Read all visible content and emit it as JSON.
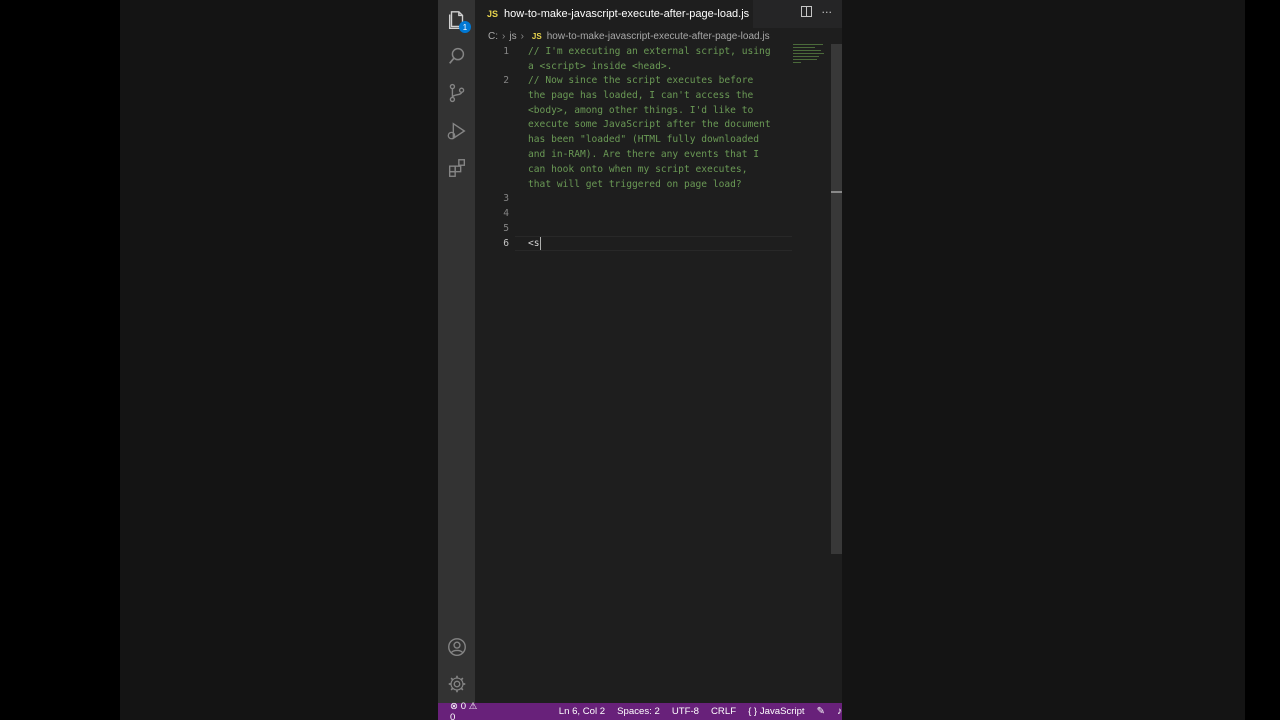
{
  "window": {
    "tab_title": "how-to-make-javascript-execute-after-page-load.js",
    "tab_lang_badge": "JS",
    "tab_modified": true
  },
  "breadcrumbs": {
    "drive": "C:",
    "folder": "js",
    "file_badge": "JS",
    "file": "how-to-make-javascript-execute-after-page-load.js"
  },
  "activity_bar": {
    "explorer_badge": "1",
    "items": [
      "explorer-icon",
      "search-icon",
      "source-control-icon",
      "run-debug-icon",
      "extensions-icon"
    ],
    "bottom": [
      "account-icon",
      "manage-gear-icon"
    ]
  },
  "editor": {
    "lines": [
      {
        "number": "1",
        "text": [
          "// I'm executing an external script, using",
          "a <script> inside <head>."
        ]
      },
      {
        "number": "2",
        "text": [
          "// Now since the script executes before",
          "the page has loaded, I can't access the",
          "<body>, among other things. I'd like to",
          "execute some JavaScript after the document",
          "has been \"loaded\" (HTML fully downloaded",
          "and in-RAM). Are there any events that I",
          "can hook onto when my script executes,",
          "that will get triggered on page load?"
        ]
      },
      {
        "number": "3",
        "text": [
          ""
        ]
      },
      {
        "number": "4",
        "text": [
          ""
        ]
      },
      {
        "number": "5",
        "text": [
          ""
        ]
      },
      {
        "number": "6",
        "text": [
          "<s"
        ]
      }
    ]
  },
  "status_bar": {
    "errors": "0",
    "warnings": "0",
    "cursor_position": "Ln 6, Col 2",
    "indentation": "Spaces: 2",
    "encoding": "UTF-8",
    "eol": "CRLF",
    "language_icon": "{ }",
    "language": "JavaScript"
  },
  "colors": {
    "status_bar": "#68217a",
    "activity_bar": "#333333",
    "editor_bg": "#1e1e1e",
    "comment": "#6a9955",
    "badge": "#0078d4"
  }
}
